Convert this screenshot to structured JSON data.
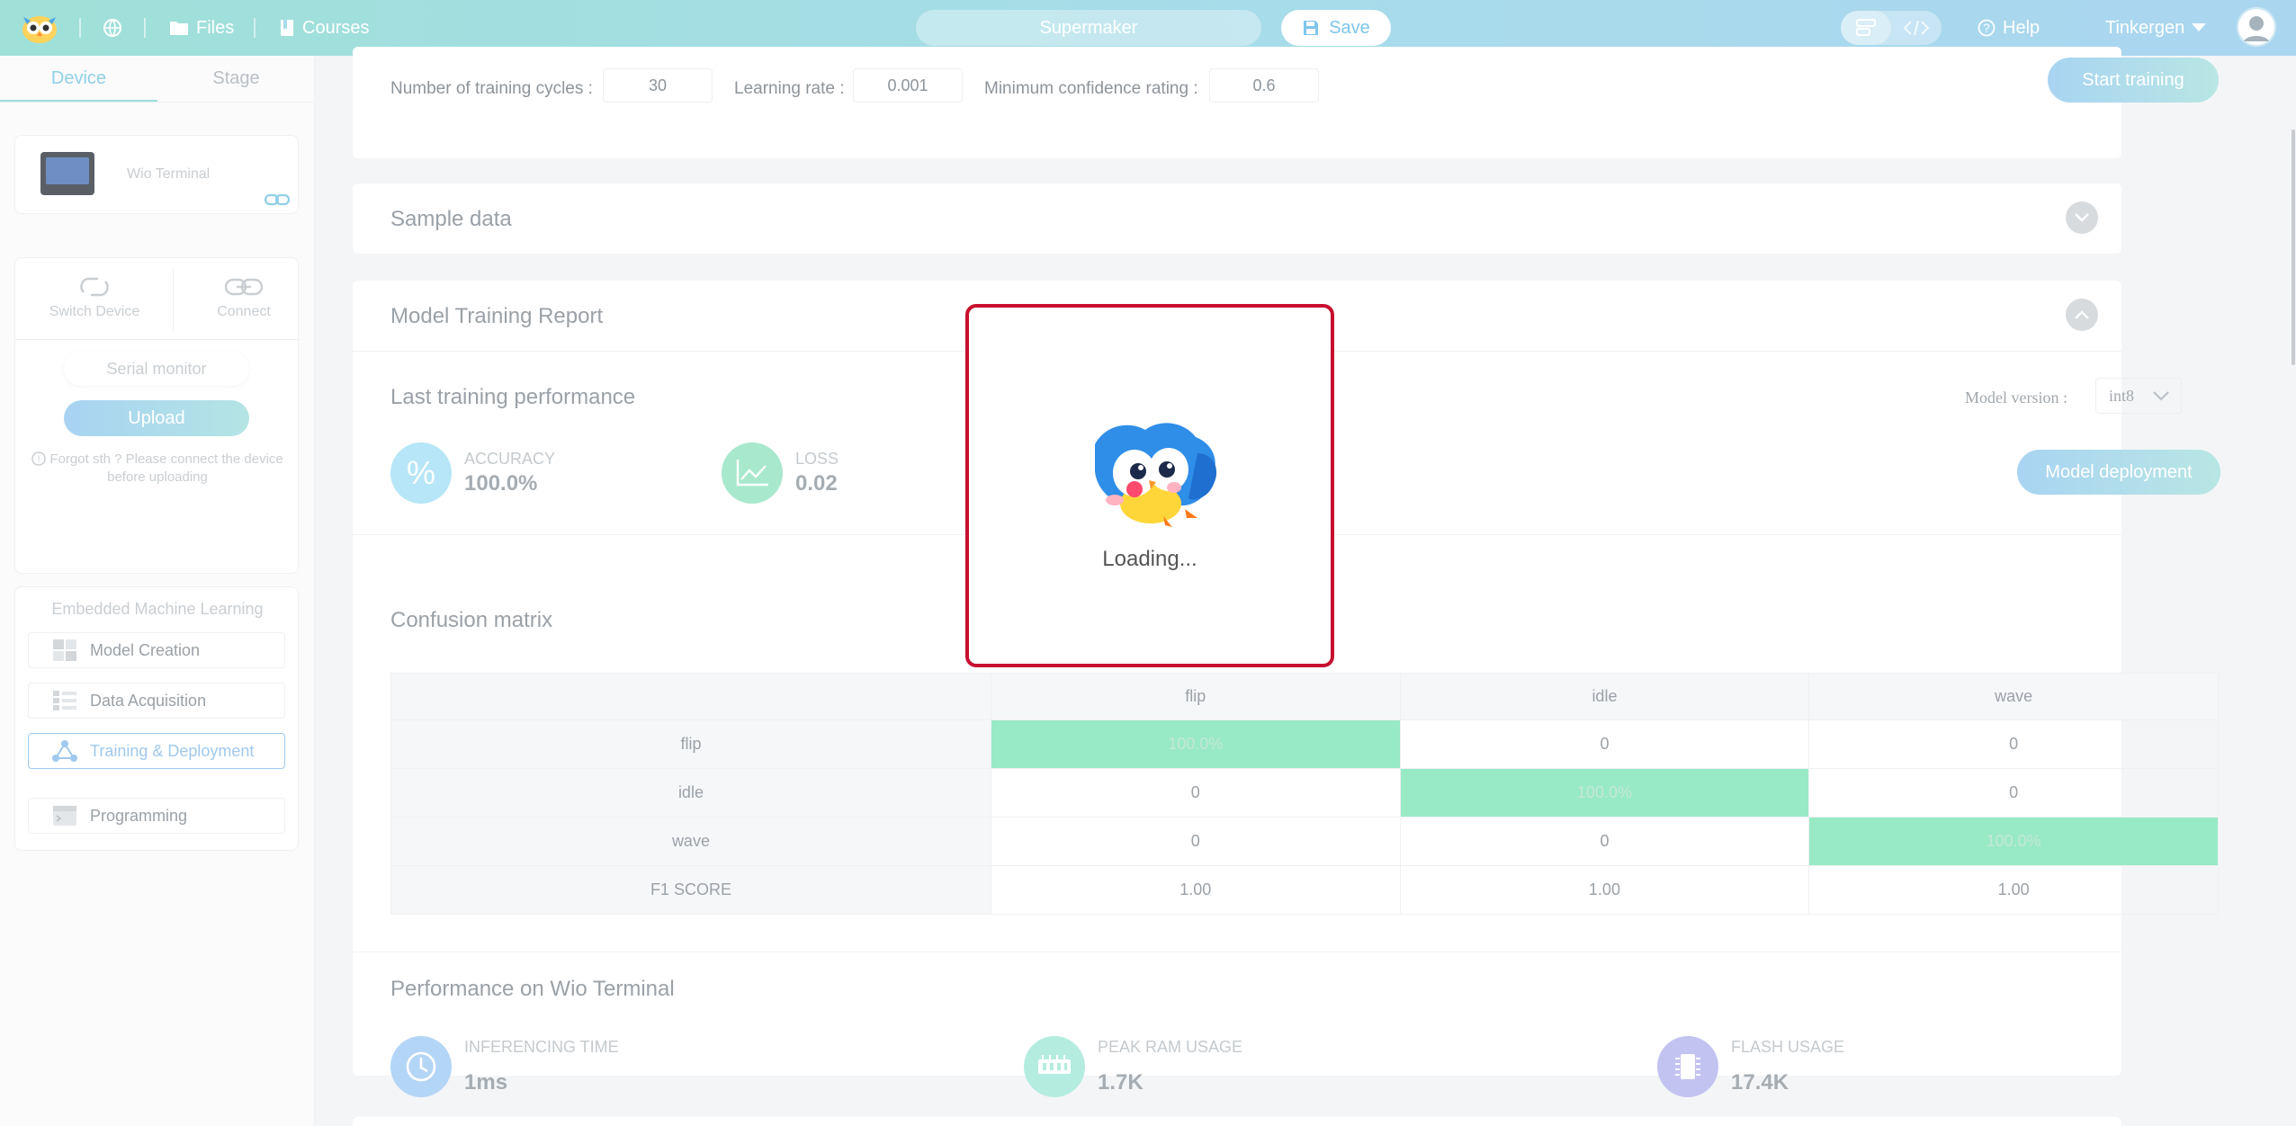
{
  "topbar": {
    "files_label": "Files",
    "courses_label": "Courses",
    "project_name": "Supermaker",
    "save_label": "Save",
    "help_label": "Help",
    "user_name": "Tinkergen",
    "icons": [
      "owl-logo-icon",
      "globe-icon",
      "folder-icon",
      "book-icon",
      "save-icon",
      "blocks-icon",
      "code-icon",
      "help-icon",
      "caret-down-icon"
    ]
  },
  "sidebar": {
    "tabs": [
      {
        "label": "Device",
        "active": true
      },
      {
        "label": "Stage",
        "active": false
      }
    ],
    "device_name": "Wio Terminal",
    "switch_device_label": "Switch Device",
    "connect_label": "Connect",
    "serial_monitor_label": "Serial monitor",
    "upload_label": "Upload",
    "upload_hint": "Forgot sth ? Please connect the device before uploading",
    "ml_title": "Embedded Machine Learning",
    "ml_items": [
      {
        "label": "Model Creation",
        "active": false
      },
      {
        "label": "Data Acquisition",
        "active": false
      },
      {
        "label": "Training & Deployment",
        "active": true
      }
    ],
    "programming_label": "Programming"
  },
  "config": {
    "cycles_label": "Number of training cycles :",
    "cycles_value": "30",
    "lr_label": "Learning rate :",
    "lr_value": "0.001",
    "conf_label": "Minimum confidence rating :",
    "conf_value": "0.6",
    "start_training_label": "Start training"
  },
  "sample_panel": {
    "title": "Sample data"
  },
  "report": {
    "title": "Model Training Report",
    "last_perf_title": "Last training performance",
    "accuracy_label": "ACCURACY",
    "accuracy_value": "100.0%",
    "loss_label": "LOSS",
    "loss_value": "0.02",
    "model_version_label": "Model version :",
    "model_version_value": "int8",
    "deploy_label": "Model deployment",
    "confusion_title": "Confusion matrix",
    "matrix": {
      "columns": [
        "",
        "flip",
        "idle",
        "wave"
      ],
      "rows": [
        {
          "label": "flip",
          "cells": [
            "100.0%",
            "0",
            "0"
          ],
          "hit": 0
        },
        {
          "label": "idle",
          "cells": [
            "0",
            "100.0%",
            "0"
          ],
          "hit": 1
        },
        {
          "label": "wave",
          "cells": [
            "0",
            "0",
            "100.0%"
          ],
          "hit": 2
        },
        {
          "label": "F1 SCORE",
          "cells": [
            "1.00",
            "1.00",
            "1.00"
          ],
          "hit": -1
        }
      ]
    },
    "device_perf_title": "Performance on Wio Terminal",
    "inferencing_label": "INFERENCING TIME",
    "inferencing_value": "1ms",
    "ram_label": "PEAK RAM USAGE",
    "ram_value": "1.7K",
    "flash_label": "FLASH USAGE",
    "flash_value": "17.4K"
  },
  "loading": {
    "text": "Loading..."
  },
  "colors": {
    "accent": "#9fd6ec",
    "matrix_hit": "#98e9c5",
    "loading_border": "#c8102e"
  }
}
